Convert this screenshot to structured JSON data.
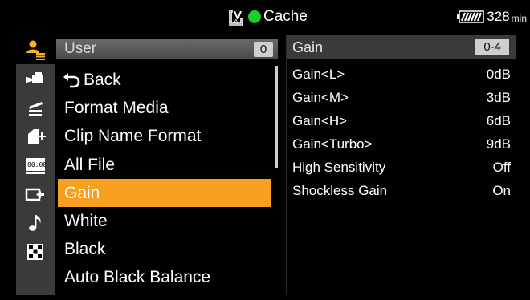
{
  "status_bar": {
    "cache_label": "Cache",
    "battery_value": "328",
    "battery_unit": "min",
    "rec_color": "#17d02a"
  },
  "category_icons": [
    {
      "name": "user-menu-icon",
      "active": true
    },
    {
      "name": "camera-icon",
      "active": false
    },
    {
      "name": "clapper-icon",
      "active": false
    },
    {
      "name": "media-card-icon",
      "active": false
    },
    {
      "name": "timecode-icon",
      "active": false
    },
    {
      "name": "output-icon",
      "active": false
    },
    {
      "name": "audio-note-icon",
      "active": false
    },
    {
      "name": "checker-icon",
      "active": false
    }
  ],
  "menu": {
    "header_title": "User",
    "header_badge": "0",
    "items": [
      {
        "label": "Back",
        "icon": "back-arrow-icon",
        "selected": false
      },
      {
        "label": "Format Media",
        "selected": false
      },
      {
        "label": "Clip Name Format",
        "selected": false
      },
      {
        "label": "All File",
        "selected": false
      },
      {
        "label": "Gain",
        "selected": true
      },
      {
        "label": "White",
        "selected": false
      },
      {
        "label": "Black",
        "selected": false
      },
      {
        "label": "Auto Black Balance",
        "selected": false
      }
    ],
    "selected_color": "#f7a01f"
  },
  "detail": {
    "title": "Gain",
    "range": "0-4",
    "rows": [
      {
        "label": "Gain<L>",
        "value": "0dB"
      },
      {
        "label": "Gain<M>",
        "value": "3dB"
      },
      {
        "label": "Gain<H>",
        "value": "6dB"
      },
      {
        "label": "Gain<Turbo>",
        "value": "9dB"
      },
      {
        "label": "High Sensitivity",
        "value": "Off"
      },
      {
        "label": "Shockless Gain",
        "value": "On"
      }
    ]
  }
}
